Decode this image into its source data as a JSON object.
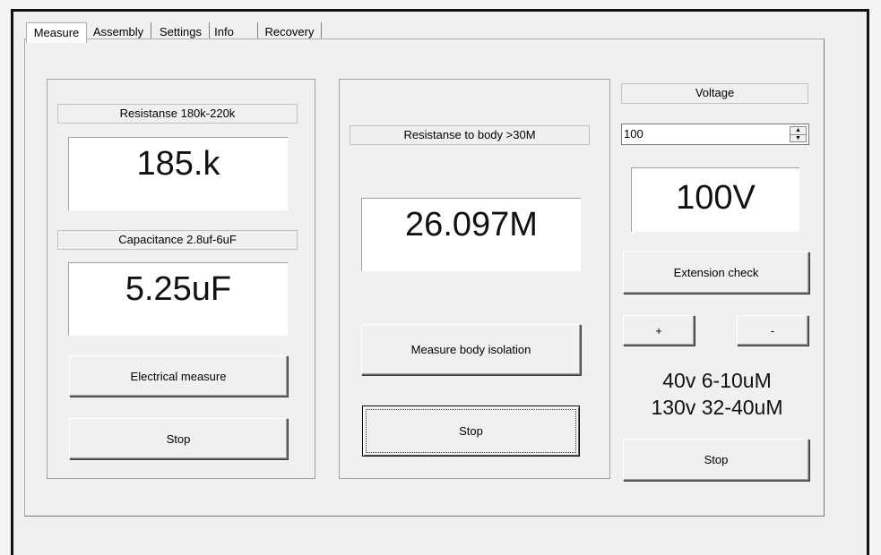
{
  "tabs": [
    {
      "label": "Measure",
      "active": true
    },
    {
      "label": "Assembly",
      "active": false
    },
    {
      "label": "Settings",
      "active": false
    },
    {
      "label": "Info",
      "active": false
    },
    {
      "label": "Recovery",
      "active": false
    }
  ],
  "left_panel": {
    "resistance_label": "Resistanse 180k-220k",
    "resistance_value": "185.k",
    "capacitance_label": "Capacitance 2.8uf-6uF",
    "capacitance_value": "5.25uF",
    "electrical_measure_button": "Electrical measure",
    "stop_button": "Stop"
  },
  "middle_panel": {
    "body_resistance_label": "Resistanse to body >30M",
    "body_resistance_value": "26.097M",
    "measure_body_isolation_button": "Measure body isolation",
    "stop_button": "Stop"
  },
  "right_panel": {
    "voltage_label": "Voltage",
    "voltage_input_value": "100",
    "voltage_display": "100V",
    "extension_check_button": "Extension check",
    "plus_button": "+",
    "minus_button": "-",
    "range_line_1": "40v 6-10uM",
    "range_line_2": "130v  32-40uM",
    "stop_button": "Stop"
  },
  "icons": {
    "spin_up": "spin-up-arrow-icon",
    "spin_down": "spin-down-arrow-icon"
  }
}
